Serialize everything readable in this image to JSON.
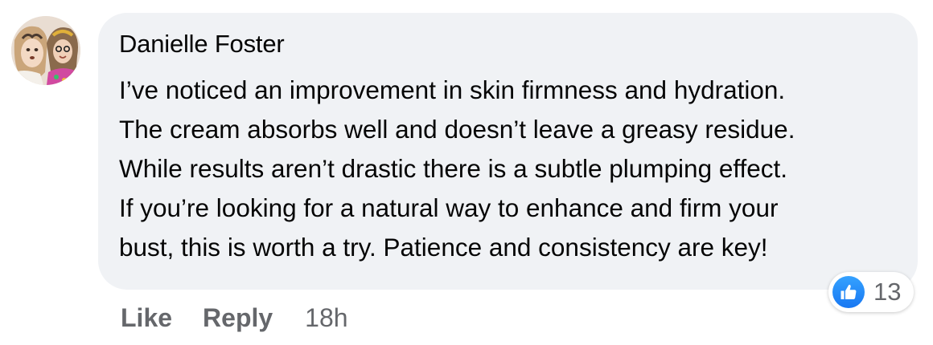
{
  "comment": {
    "author": "Danielle Foster",
    "lines": [
      "I’ve noticed an improvement in skin firmness and hydration.",
      "The cream absorbs well and doesn’t leave a greasy residue.",
      "While results aren’t drastic there is a subtle plumping effect.",
      "If you’re looking for a natural way to enhance and firm your",
      "bust, this is worth a try. Patience and consistency are key!"
    ],
    "avatar_icon": "profile-photo",
    "reaction": {
      "icon": "thumbs-up-icon",
      "count": "13",
      "color": "#1877f2"
    }
  },
  "actions": {
    "like_label": "Like",
    "reply_label": "Reply",
    "timestamp": "18h"
  },
  "colors": {
    "bubble": "#f0f2f5",
    "text": "#050505",
    "secondary": "#65676b"
  }
}
